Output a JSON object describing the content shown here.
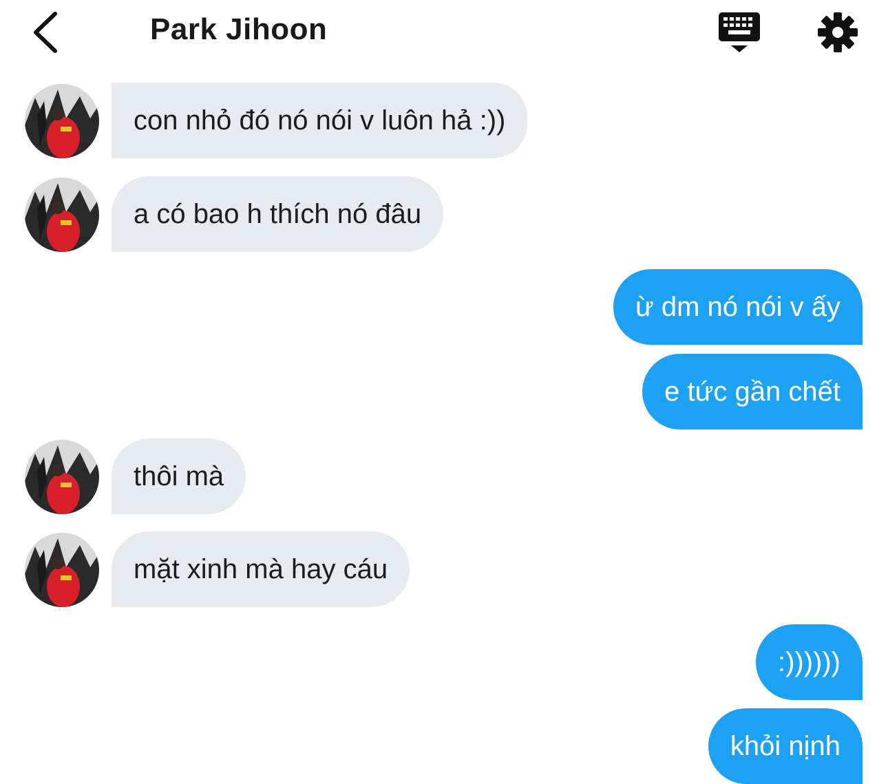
{
  "header": {
    "title": "Park Jihoon",
    "back_icon": "chevron-left-icon",
    "keyboard_icon": "keyboard-icon",
    "settings_icon": "gear-icon"
  },
  "colors": {
    "incoming_bubble": "#e6ebef",
    "outgoing_bubble": "#1da1f2",
    "avatar_red": "#d8202a"
  },
  "messages": [
    {
      "direction": "incoming",
      "text": "con nhỏ đó nó nói v luôn hả :))"
    },
    {
      "direction": "incoming",
      "text": "a có bao h thích nó đâu"
    },
    {
      "direction": "outgoing",
      "text": "ừ dm nó nói v ấy"
    },
    {
      "direction": "outgoing",
      "text": "e tức gần chết"
    },
    {
      "direction": "incoming",
      "text": "thôi mà"
    },
    {
      "direction": "incoming",
      "text": "mặt xinh mà hay cáu"
    },
    {
      "direction": "outgoing",
      "text": ":))))))"
    },
    {
      "direction": "outgoing",
      "text": "khỏi nịnh"
    }
  ]
}
